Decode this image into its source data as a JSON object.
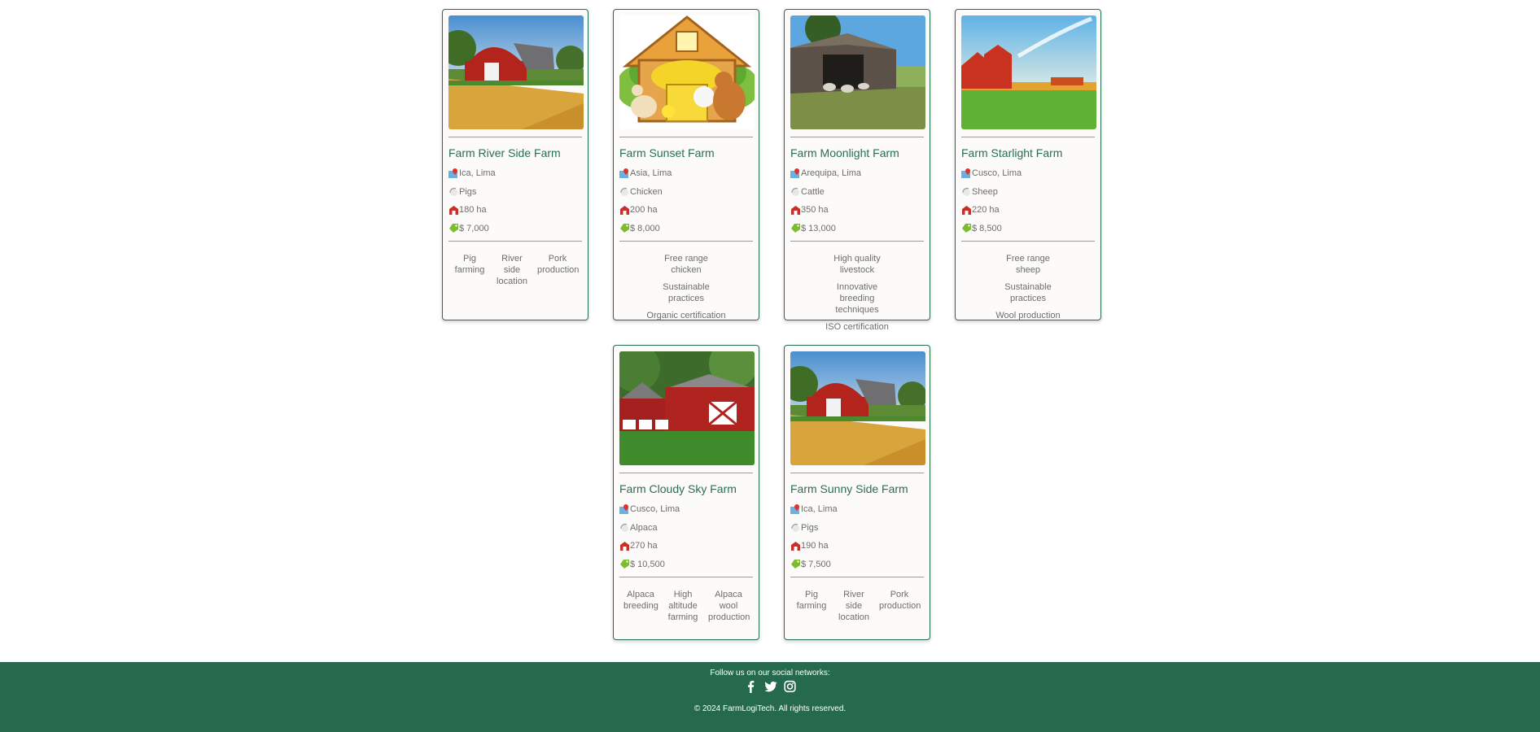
{
  "farms": [
    {
      "name": "Farm River Side Farm",
      "location": "Ica, Lima",
      "animal": "Pigs",
      "area": "180 ha",
      "price": "$ 7,000",
      "image": "barn-red-field",
      "features": [
        "Pig farming",
        "River side location",
        "Pork production"
      ]
    },
    {
      "name": "Farm Sunset Farm",
      "location": "Asia, Lima",
      "animal": "Chicken",
      "area": "200 ha",
      "price": "$ 8,000",
      "image": "cartoon-barn-animals",
      "features": [
        "Free range chicken",
        "Sustainable practices",
        "Organic certification"
      ]
    },
    {
      "name": "Farm Moonlight Farm",
      "location": "Arequipa, Lima",
      "animal": "Cattle",
      "area": "350 ha",
      "price": "$ 13,000",
      "image": "wooden-barn-sheep",
      "features": [
        "High quality livestock",
        "Innovative breeding techniques",
        "ISO certification"
      ]
    },
    {
      "name": "Farm Starlight Farm",
      "location": "Cusco, Lima",
      "animal": "Sheep",
      "area": "220 ha",
      "price": "$ 8,500",
      "image": "red-barn-sunset",
      "features": [
        "Free range sheep",
        "Sustainable practices",
        "Wool production"
      ]
    },
    {
      "name": "Farm Cloudy Sky Farm",
      "location": "Cusco, Lima",
      "animal": "Alpaca",
      "area": "270 ha",
      "price": "$ 10,500",
      "image": "red-barns-trees",
      "features": [
        "Alpaca breeding",
        "High altitude farming",
        "Alpaca wool production"
      ]
    },
    {
      "name": "Farm Sunny Side Farm",
      "location": "Ica, Lima",
      "animal": "Pigs",
      "area": "190 ha",
      "price": "$ 7,500",
      "image": "barn-red-field",
      "features": [
        "Pig farming",
        "River side location",
        "Pork production"
      ]
    }
  ],
  "icons": {
    "location": "map-pin-icon",
    "animal": "animal-icon",
    "area": "barn-icon",
    "price": "price-tag-icon"
  },
  "footer": {
    "follow": "Follow us on our social networks:",
    "socials": [
      "facebook-icon",
      "twitter-icon",
      "instagram-icon"
    ],
    "copyright": "© 2024 FarmLogiTech. All rights reserved."
  },
  "colors": {
    "accent": "#2a6e50",
    "footer_bg": "#266a4d",
    "card_bg": "#fcfbf9",
    "text_muted": "#6d6d6d"
  }
}
